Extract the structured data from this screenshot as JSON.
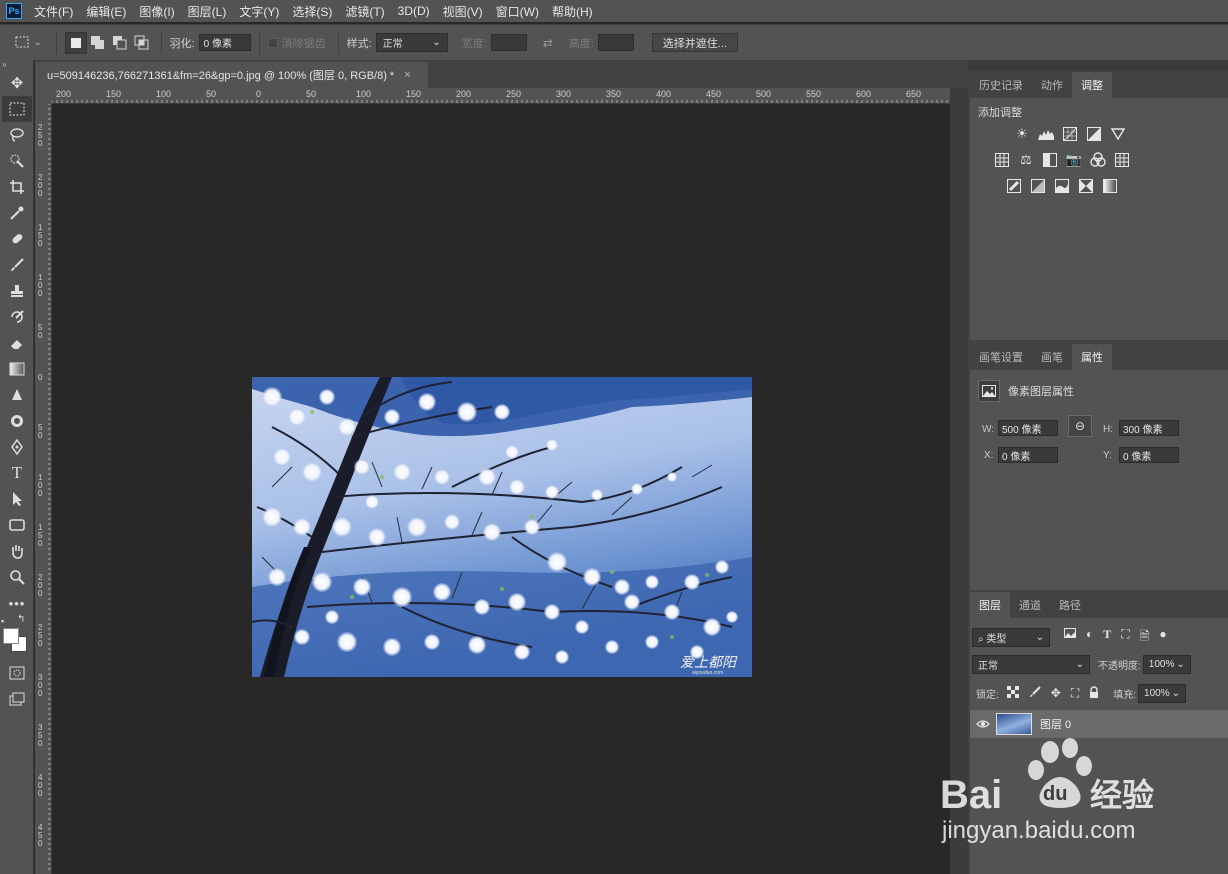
{
  "menu": {
    "logo": "Ps",
    "items": [
      "文件(F)",
      "编辑(E)",
      "图像(I)",
      "图层(L)",
      "文字(Y)",
      "选择(S)",
      "滤镜(T)",
      "3D(D)",
      "视图(V)",
      "窗口(W)",
      "帮助(H)"
    ]
  },
  "options": {
    "feather_label": "羽化:",
    "feather_value": "0 像素",
    "antialias_label": "消除锯齿",
    "style_label": "样式:",
    "style_value": "正常",
    "width_label": "宽度:",
    "height_label": "高度:",
    "select_mask_button": "选择并遮住..."
  },
  "document": {
    "tab_title": "u=509146236,766271361&fm=26&gp=0.jpg @ 100% (图层 0, RGB/8) *",
    "close": "×"
  },
  "rulers": {
    "top": [
      "200",
      "150",
      "100",
      "50",
      "0",
      "50",
      "100",
      "150",
      "200",
      "250",
      "300",
      "350",
      "400",
      "450",
      "500",
      "550",
      "600",
      "650"
    ],
    "left": [
      "250",
      "200",
      "150",
      "100",
      "50",
      "0",
      "50",
      "100",
      "150",
      "200",
      "250",
      "300",
      "350",
      "400",
      "450",
      "500"
    ]
  },
  "panel_top": {
    "tabs": [
      "历史记录",
      "动作",
      "调整"
    ],
    "active_tab": "调整",
    "add_adjustment": "添加调整"
  },
  "panel_props": {
    "tabs": [
      "画笔设置",
      "画笔",
      "属性"
    ],
    "active_tab": "属性",
    "title": "像素图层属性",
    "w_label": "W:",
    "w_value": "500 像素",
    "h_label": "H:",
    "h_value": "300 像素",
    "x_label": "X:",
    "x_value": "0 像素",
    "y_label": "Y:",
    "y_value": "0 像素"
  },
  "panel_layers": {
    "tabs": [
      "图层",
      "通道",
      "路径"
    ],
    "active_tab": "图层",
    "filter_kind": "类型",
    "blend_mode": "正常",
    "opacity_label": "不透明度:",
    "opacity_value": "100%",
    "lock_label": "锁定:",
    "fill_label": "填充:",
    "fill_value": "100%",
    "layers": [
      {
        "name": "图层 0",
        "visible": true
      }
    ]
  },
  "photo": {
    "signature": "爱上都阳",
    "signature_sub": "aiyouduo.com"
  },
  "watermark": {
    "brand": "Bai",
    "brand_du": "du",
    "brand_cn": "经验",
    "url": "jingyan.baidu.com"
  },
  "colors": {
    "chrome": "#535353",
    "canvas_bg": "#282828",
    "accent": "#31a8ff"
  }
}
